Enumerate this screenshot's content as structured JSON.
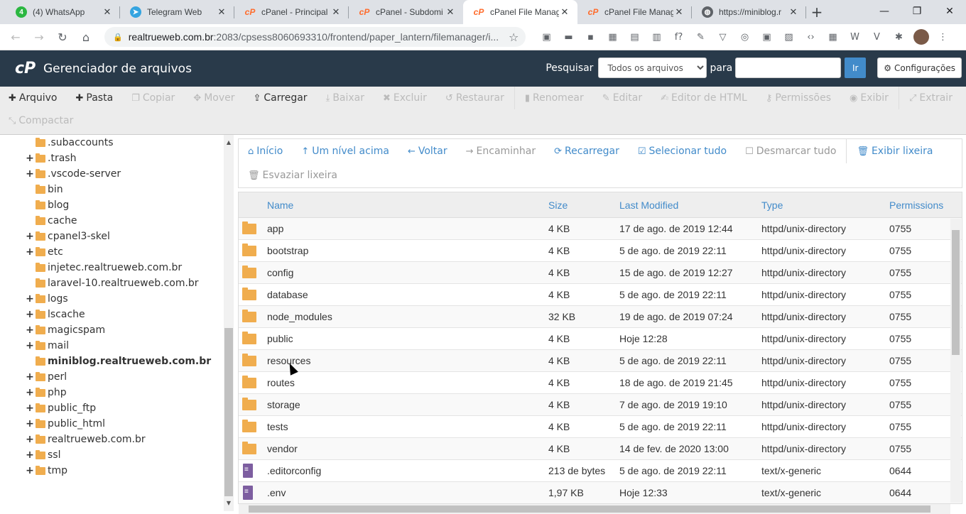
{
  "browser": {
    "tabs": [
      {
        "title": "(4) WhatsApp",
        "icon": "whatsapp-icon",
        "favicon": "4"
      },
      {
        "title": "Telegram Web",
        "icon": "telegram-icon",
        "favicon": "➤"
      },
      {
        "title": "cPanel - Principal",
        "icon": "cpanel-icon",
        "favicon": "cP"
      },
      {
        "title": "cPanel - Subdomi",
        "icon": "cpanel-icon",
        "favicon": "cP"
      },
      {
        "title": "cPanel File Manag",
        "icon": "cpanel-icon",
        "favicon": "cP",
        "active": true
      },
      {
        "title": "cPanel File Manag",
        "icon": "cpanel-icon",
        "favicon": "cP"
      },
      {
        "title": "https://miniblog.r",
        "icon": "globe-icon",
        "favicon": "◍"
      }
    ],
    "new_tab": "+",
    "window_controls": {
      "minimize": "—",
      "restore": "❐",
      "close": "✕"
    },
    "url_host": "realtrueweb.com.br",
    "url_path": ":2083/cpsess8060693310/frontend/paper_lantern/filemanager/i...",
    "nav": {
      "back": "←",
      "forward": "→",
      "reload": "↻",
      "home": "⌂"
    },
    "extensions": [
      "▣",
      "▬",
      "▪",
      "▦",
      "▤",
      "▥",
      "f?",
      "✎",
      "▽",
      "◎",
      "▣",
      "▨",
      "‹›",
      "▦",
      "W",
      "V",
      "✱"
    ]
  },
  "header": {
    "logo": "cP",
    "title": "Gerenciador de arquivos",
    "search_label": "Pesquisar",
    "search_scope": "Todos os arquivos",
    "for_label": "para",
    "search_value": "",
    "go_label": "Ir",
    "settings_label": "Configurações"
  },
  "actions": [
    {
      "label": "Arquivo",
      "icon": "plus-icon",
      "glyph": "✚",
      "enabled": true
    },
    {
      "label": "Pasta",
      "icon": "plus-icon",
      "glyph": "✚",
      "enabled": true
    },
    {
      "label": "Copiar",
      "icon": "copy-icon",
      "glyph": "❐",
      "enabled": false
    },
    {
      "label": "Mover",
      "icon": "move-icon",
      "glyph": "✥",
      "enabled": false
    },
    {
      "label": "Carregar",
      "icon": "upload-icon",
      "glyph": "⇪",
      "enabled": true
    },
    {
      "label": "Baixar",
      "icon": "download-icon",
      "glyph": "⤓",
      "enabled": false
    },
    {
      "label": "Excluir",
      "icon": "delete-icon",
      "glyph": "✖",
      "enabled": false
    },
    {
      "label": "Restaurar",
      "icon": "restore-icon",
      "glyph": "↺",
      "enabled": false
    },
    {
      "label": "Renomear",
      "icon": "rename-icon",
      "glyph": "▮",
      "enabled": false
    },
    {
      "label": "Editar",
      "icon": "pencil-icon",
      "glyph": "✎",
      "enabled": false
    },
    {
      "label": "Editor de HTML",
      "icon": "html-editor-icon",
      "glyph": "✍",
      "enabled": false
    },
    {
      "label": "Permissões",
      "icon": "key-icon",
      "glyph": "⚷",
      "enabled": false
    },
    {
      "label": "Exibir",
      "icon": "eye-icon",
      "glyph": "◉",
      "enabled": false
    },
    {
      "label": "Extrair",
      "icon": "extract-icon",
      "glyph": "⤢",
      "enabled": false
    },
    {
      "label": "Compactar",
      "icon": "compress-icon",
      "glyph": "⤡",
      "enabled": false
    }
  ],
  "tree": [
    {
      "label": ".subaccounts",
      "expandable": false
    },
    {
      "label": ".trash",
      "expandable": true
    },
    {
      "label": ".vscode-server",
      "expandable": true
    },
    {
      "label": "bin",
      "expandable": false
    },
    {
      "label": "blog",
      "expandable": false
    },
    {
      "label": "cache",
      "expandable": false
    },
    {
      "label": "cpanel3-skel",
      "expandable": true
    },
    {
      "label": "etc",
      "expandable": true
    },
    {
      "label": "injetec.realtrueweb.com.br",
      "expandable": false
    },
    {
      "label": "laravel-10.realtrueweb.com.br",
      "expandable": false
    },
    {
      "label": "logs",
      "expandable": true
    },
    {
      "label": "lscache",
      "expandable": true
    },
    {
      "label": "magicspam",
      "expandable": true
    },
    {
      "label": "mail",
      "expandable": true
    },
    {
      "label": "miniblog.realtrueweb.com.br",
      "expandable": false,
      "selected": true
    },
    {
      "label": "perl",
      "expandable": true
    },
    {
      "label": "php",
      "expandable": true
    },
    {
      "label": "public_ftp",
      "expandable": true
    },
    {
      "label": "public_html",
      "expandable": true
    },
    {
      "label": "realtrueweb.com.br",
      "expandable": true
    },
    {
      "label": "ssl",
      "expandable": true
    },
    {
      "label": "tmp",
      "expandable": true
    }
  ],
  "navbar": [
    {
      "label": "Início",
      "icon": "home-icon",
      "glyph": "⌂",
      "enabled": true
    },
    {
      "label": "Um nível acima",
      "icon": "level-up-icon",
      "glyph": "↑",
      "enabled": true
    },
    {
      "label": "Voltar",
      "icon": "back-arrow-icon",
      "glyph": "←",
      "enabled": true
    },
    {
      "label": "Encaminhar",
      "icon": "forward-arrow-icon",
      "glyph": "→",
      "enabled": false
    },
    {
      "label": "Recarregar",
      "icon": "refresh-icon",
      "glyph": "⟳",
      "enabled": true
    },
    {
      "label": "Selecionar tudo",
      "icon": "checkbox-checked-icon",
      "glyph": "☑",
      "enabled": true
    },
    {
      "label": "Desmarcar tudo",
      "icon": "checkbox-empty-icon",
      "glyph": "☐",
      "enabled": false
    },
    {
      "label": "Exibir lixeira",
      "icon": "trash-icon",
      "glyph": "🗑",
      "enabled": true
    },
    {
      "label": "Esvaziar lixeira",
      "icon": "trash-icon",
      "glyph": "🗑",
      "enabled": false
    }
  ],
  "table": {
    "columns": [
      "Name",
      "Size",
      "Last Modified",
      "Type",
      "Permissions"
    ],
    "rows": [
      {
        "kind": "folder",
        "name": "app",
        "size": "4 KB",
        "modified": "17 de ago. de 2019 12:44",
        "type": "httpd/unix-directory",
        "perms": "0755"
      },
      {
        "kind": "folder",
        "name": "bootstrap",
        "size": "4 KB",
        "modified": "5 de ago. de 2019 22:11",
        "type": "httpd/unix-directory",
        "perms": "0755"
      },
      {
        "kind": "folder",
        "name": "config",
        "size": "4 KB",
        "modified": "15 de ago. de 2019 12:27",
        "type": "httpd/unix-directory",
        "perms": "0755"
      },
      {
        "kind": "folder",
        "name": "database",
        "size": "4 KB",
        "modified": "5 de ago. de 2019 22:11",
        "type": "httpd/unix-directory",
        "perms": "0755"
      },
      {
        "kind": "folder",
        "name": "node_modules",
        "size": "32 KB",
        "modified": "19 de ago. de 2019 07:24",
        "type": "httpd/unix-directory",
        "perms": "0755"
      },
      {
        "kind": "folder",
        "name": "public",
        "size": "4 KB",
        "modified": "Hoje 12:28",
        "type": "httpd/unix-directory",
        "perms": "0755"
      },
      {
        "kind": "folder",
        "name": "resources",
        "size": "4 KB",
        "modified": "5 de ago. de 2019 22:11",
        "type": "httpd/unix-directory",
        "perms": "0755"
      },
      {
        "kind": "folder",
        "name": "routes",
        "size": "4 KB",
        "modified": "18 de ago. de 2019 21:45",
        "type": "httpd/unix-directory",
        "perms": "0755"
      },
      {
        "kind": "folder",
        "name": "storage",
        "size": "4 KB",
        "modified": "7 de ago. de 2019 19:10",
        "type": "httpd/unix-directory",
        "perms": "0755"
      },
      {
        "kind": "folder",
        "name": "tests",
        "size": "4 KB",
        "modified": "5 de ago. de 2019 22:11",
        "type": "httpd/unix-directory",
        "perms": "0755"
      },
      {
        "kind": "folder",
        "name": "vendor",
        "size": "4 KB",
        "modified": "14 de fev. de 2020 13:00",
        "type": "httpd/unix-directory",
        "perms": "0755"
      },
      {
        "kind": "file",
        "name": ".editorconfig",
        "size": "213 de bytes",
        "modified": "5 de ago. de 2019 22:11",
        "type": "text/x-generic",
        "perms": "0644"
      },
      {
        "kind": "file",
        "name": ".env",
        "size": "1,97 KB",
        "modified": "Hoje 12:33",
        "type": "text/x-generic",
        "perms": "0644"
      }
    ]
  },
  "colors": {
    "header_bg": "#293a4a",
    "link": "#428bca",
    "folder": "#f0ad4e",
    "file": "#7d5ea0",
    "go_button": "#428bca"
  }
}
